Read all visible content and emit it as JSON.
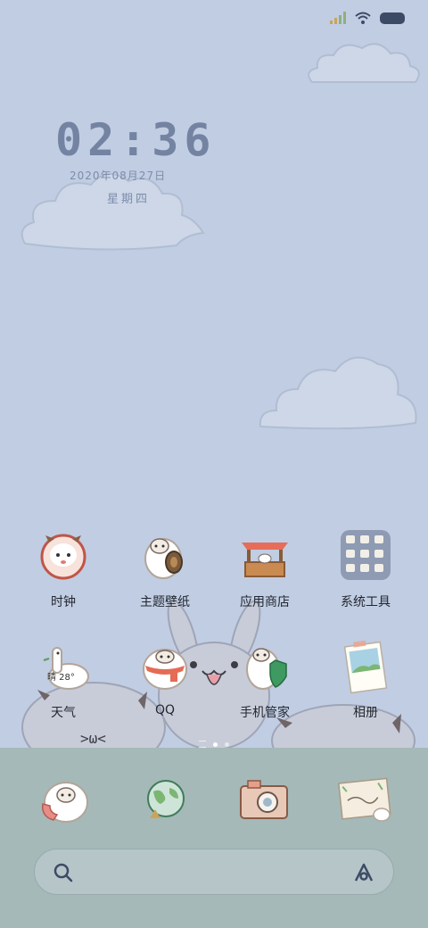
{
  "clock": {
    "time": "02:36",
    "date": "2020年08月27日",
    "weekday": "星期四"
  },
  "apps": [
    {
      "label": "时钟",
      "icon": "clock-sheep-icon"
    },
    {
      "label": "主题壁纸",
      "icon": "themes-sheep-icon"
    },
    {
      "label": "应用商店",
      "icon": "app-store-stall-icon"
    },
    {
      "label": "系统工具",
      "icon": "system-tools-folder-icon"
    },
    {
      "label": "天气",
      "icon": "weather-alpaca-icon",
      "temp": "晴 28°"
    },
    {
      "label": "QQ",
      "icon": "qq-sheep-icon"
    },
    {
      "label": "手机管家",
      "icon": "security-sheep-icon"
    },
    {
      "label": "相册",
      "icon": "gallery-photo-icon"
    }
  ],
  "dock": [
    {
      "icon": "phone-sheep-icon"
    },
    {
      "icon": "browser-globe-icon"
    },
    {
      "icon": "camera-icon"
    },
    {
      "icon": "messages-letter-icon"
    }
  ],
  "search": {
    "placeholder": ""
  },
  "colors": {
    "wallpaper": "#c1cde2",
    "dock": "#a5b9b8",
    "clock_text": "#7383a1"
  }
}
